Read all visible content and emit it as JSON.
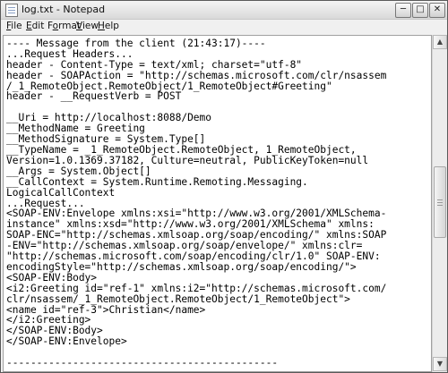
{
  "window": {
    "title": "log.txt - Notepad"
  },
  "menu": [
    {
      "accel": "F",
      "rest": "ile"
    },
    {
      "accel": "E",
      "rest": "dit"
    },
    {
      "pre": "F",
      "accel": "o",
      "rest": "rmat"
    },
    {
      "accel": "V",
      "rest": "iew"
    },
    {
      "accel": "H",
      "rest": "elp"
    }
  ],
  "content": {
    "lines": [
      "---------------------------------------------",
      "---- Message from the client (21:43:17)----",
      "...Request Headers...",
      "header - Content-Type = text/xml; charset=\"utf-8\"",
      "header - SOAPAction = \"http://schemas.microsoft.com/clr/nsassem",
      "/_1_RemoteObject.RemoteObject/1_RemoteObject#Greeting\"",
      "header - __RequestVerb = POST",
      "",
      "__Uri = http://localhost:8088/Demo",
      "__MethodName = Greeting",
      "__MethodSignature = System.Type[]",
      "__TypeName = _1_RemoteObject.RemoteObject, 1_RemoteObject,",
      "Version=1.0.1369.37182, Culture=neutral, PublicKeyToken=null",
      "__Args = System.Object[]",
      "__CallContext = System.Runtime.Remoting.Messaging.",
      "LogicalCallContext",
      "...Request...",
      "<SOAP-ENV:Envelope xmlns:xsi=\"http://www.w3.org/2001/XMLSchema-",
      "instance\" xmlns:xsd=\"http://www.w3.org/2001/XMLSchema\" xmlns:",
      "SOAP-ENC=\"http://schemas.xmlsoap.org/soap/encoding/\" xmlns:SOAP",
      "-ENV=\"http://schemas.xmlsoap.org/soap/envelope/\" xmlns:clr=",
      "\"http://schemas.microsoft.com/soap/encoding/clr/1.0\" SOAP-ENV:",
      "encodingStyle=\"http://schemas.xmlsoap.org/soap/encoding/\">",
      "<SOAP-ENV:Body>",
      "<i2:Greeting id=\"ref-1\" xmlns:i2=\"http://schemas.microsoft.com/",
      "clr/nsassem/_1_RemoteObject.RemoteObject/1_RemoteObject\">",
      "<name id=\"ref-3\">Christian</name>",
      "</i2:Greeting>",
      "</SOAP-ENV:Body>",
      "</SOAP-ENV:Envelope>",
      "",
      "---------------------------------------------"
    ]
  }
}
